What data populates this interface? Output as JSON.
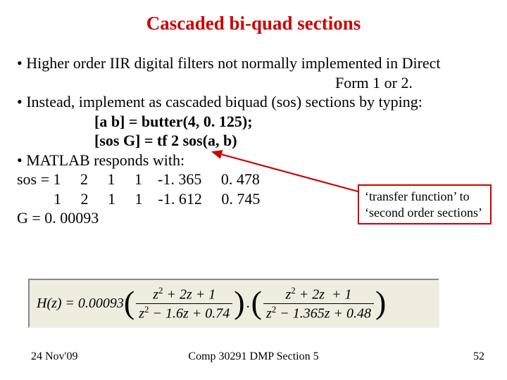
{
  "title": "Cascaded bi-quad sections",
  "lines": {
    "l1": "• Higher order IIR digital filters not normally implemented in Direct",
    "l2": "Form 1 or 2.",
    "l3": "• Instead, implement as cascaded biquad (sos) sections by typing:",
    "l4": "[a b] = butter(4, 0. 125);",
    "l5": "[sos G] = tf 2 sos(a, b)",
    "l6": "• MATLAB responds with:",
    "l7": "sos = 1     2     1     1    -1. 365     0. 478",
    "l8": "1     2     1     1    -1. 612     0. 745",
    "l9": "G = 0. 00093"
  },
  "callout": {
    "line1": "‘transfer function’ to",
    "line2": "‘second order sections’"
  },
  "equation": {
    "lhs": "H(z)",
    "coeff": "0.00093",
    "frac1_num": "z² + 2z + 1",
    "frac1_den": "z² − 1.6z + 0.74",
    "frac2_num": "z² + 2z  + 1",
    "frac2_den": "z² − 1.365z + 0.48"
  },
  "footer": {
    "left": "24 Nov'09",
    "center": "Comp 30291 DMP Section 5",
    "right": "52"
  }
}
